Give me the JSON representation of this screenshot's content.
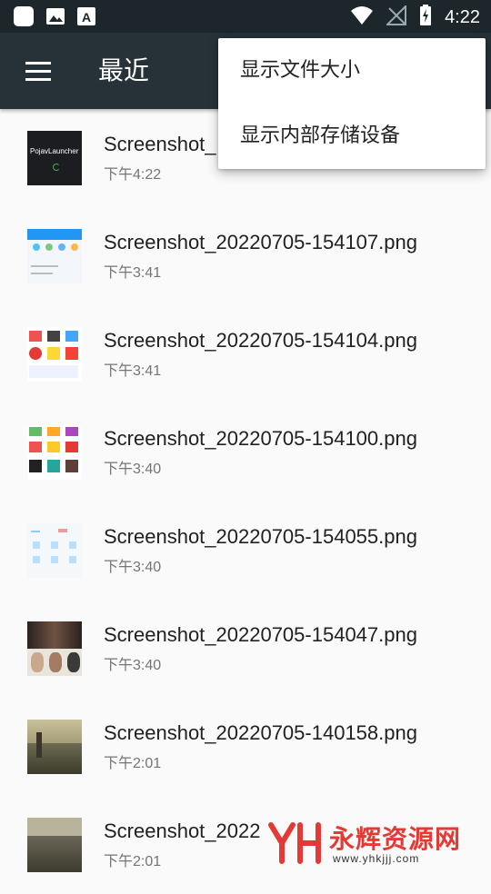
{
  "status_bar": {
    "time": "4:22",
    "icons": [
      "app-icon",
      "image-icon",
      "a-icon",
      "wifi-icon",
      "no-signal-icon",
      "battery-charging-icon"
    ]
  },
  "toolbar": {
    "title": "最近",
    "menu_icon": "hamburger-menu-icon"
  },
  "files": [
    {
      "name": "Screenshot_",
      "time": "下午4:22",
      "thumb_text": "PojavLauncher"
    },
    {
      "name": "Screenshot_20220705-154107.png",
      "time": "下午3:41"
    },
    {
      "name": "Screenshot_20220705-154104.png",
      "time": "下午3:41"
    },
    {
      "name": "Screenshot_20220705-154100.png",
      "time": "下午3:40"
    },
    {
      "name": "Screenshot_20220705-154055.png",
      "time": "下午3:40"
    },
    {
      "name": "Screenshot_20220705-154047.png",
      "time": "下午3:40"
    },
    {
      "name": "Screenshot_20220705-140158.png",
      "time": "下午2:01"
    },
    {
      "name": "Screenshot_2022",
      "time": "下午2:01"
    }
  ],
  "overflow_menu": {
    "items": [
      "显示文件大小",
      "显示内部存储设备"
    ]
  },
  "watermark": {
    "text": "永辉资源网",
    "url": "www.yhkjjj.com",
    "logo": "YH"
  }
}
